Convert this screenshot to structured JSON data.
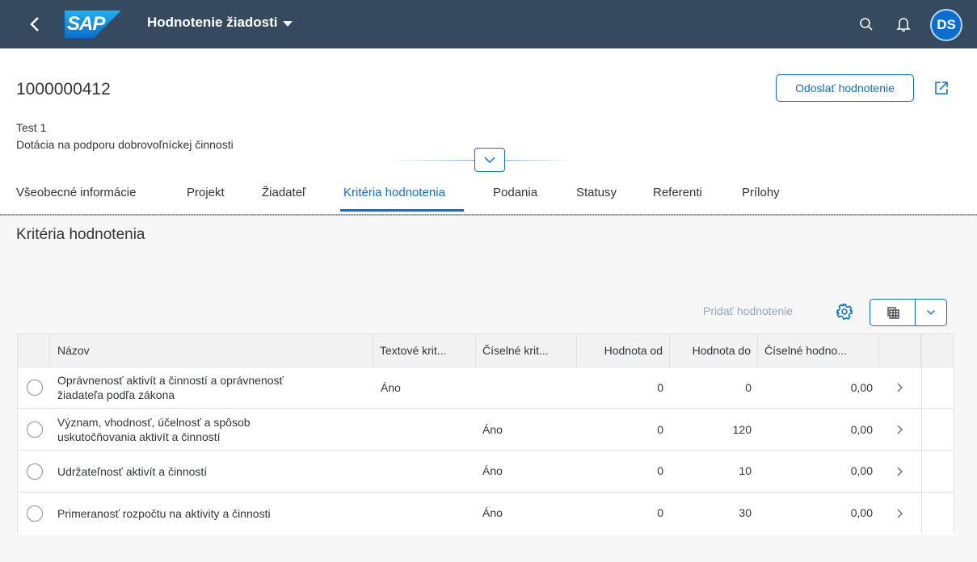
{
  "shell": {
    "back_icon": "back-chevron-icon",
    "logo_text": "SAP",
    "app_title": "Hodnotenie žiadosti",
    "search_icon": "search-icon",
    "notifications_icon": "bell-icon",
    "avatar_initials": "DS",
    "colors": {
      "bar": "#354a5f",
      "avatar": "#0a6ed1",
      "accent": "#0a6ed1"
    }
  },
  "header": {
    "object_id": "1000000412",
    "primary_action": "Odoslať hodnotenie",
    "share_icon": "share-icon",
    "subtitle_line1": "Test 1",
    "subtitle_line2": "Dotácia na podporu dobrovoľníckej činnosti",
    "collapse_icon": "chevron-down-icon"
  },
  "tabs": [
    {
      "label": "Všeobecné informácie",
      "active": false
    },
    {
      "label": "Projekt",
      "active": false
    },
    {
      "label": "Žiadateľ",
      "active": false
    },
    {
      "label": "Kritéria hodnotenia",
      "active": true
    },
    {
      "label": "Podania",
      "active": false
    },
    {
      "label": "Statusy",
      "active": false
    },
    {
      "label": "Referenti",
      "active": false
    },
    {
      "label": "Prílohy",
      "active": false
    }
  ],
  "section": {
    "title": "Kritéria hodnotenia",
    "toolbar": {
      "add_label": "Pridať hodnotenie",
      "settings_icon": "gear-icon",
      "export_icon": "spreadsheet-export-icon",
      "export_menu_icon": "chevron-down-icon"
    }
  },
  "table": {
    "columns": [
      "Názov",
      "Textové krit...",
      "Číselné krit...",
      "Hodnota od",
      "Hodnota do",
      "Číselné hodno..."
    ],
    "rows": [
      {
        "name_line1": "Oprávnenosť aktivít a činností a oprávnenosť",
        "name_line2": "žiadateľa podľa zákona",
        "textove": "Áno",
        "ciselne": "",
        "od": "0",
        "do": "0",
        "hodnota": "0,00"
      },
      {
        "name_line1": "Význam, vhodnosť, účelnosť a spôsob",
        "name_line2": "uskutočňovania aktivít a činností",
        "textove": "",
        "ciselne": "Áno",
        "od": "0",
        "do": "120",
        "hodnota": "0,00"
      },
      {
        "name_line1": "Udržateľnosť aktivít a činností",
        "name_line2": "",
        "textove": "",
        "ciselne": "Áno",
        "od": "0",
        "do": "10",
        "hodnota": "0,00"
      },
      {
        "name_line1": "Primeranosť rozpočtu na aktivity a činnosti",
        "name_line2": "",
        "textove": "",
        "ciselne": "Áno",
        "od": "0",
        "do": "30",
        "hodnota": "0,00"
      }
    ]
  }
}
